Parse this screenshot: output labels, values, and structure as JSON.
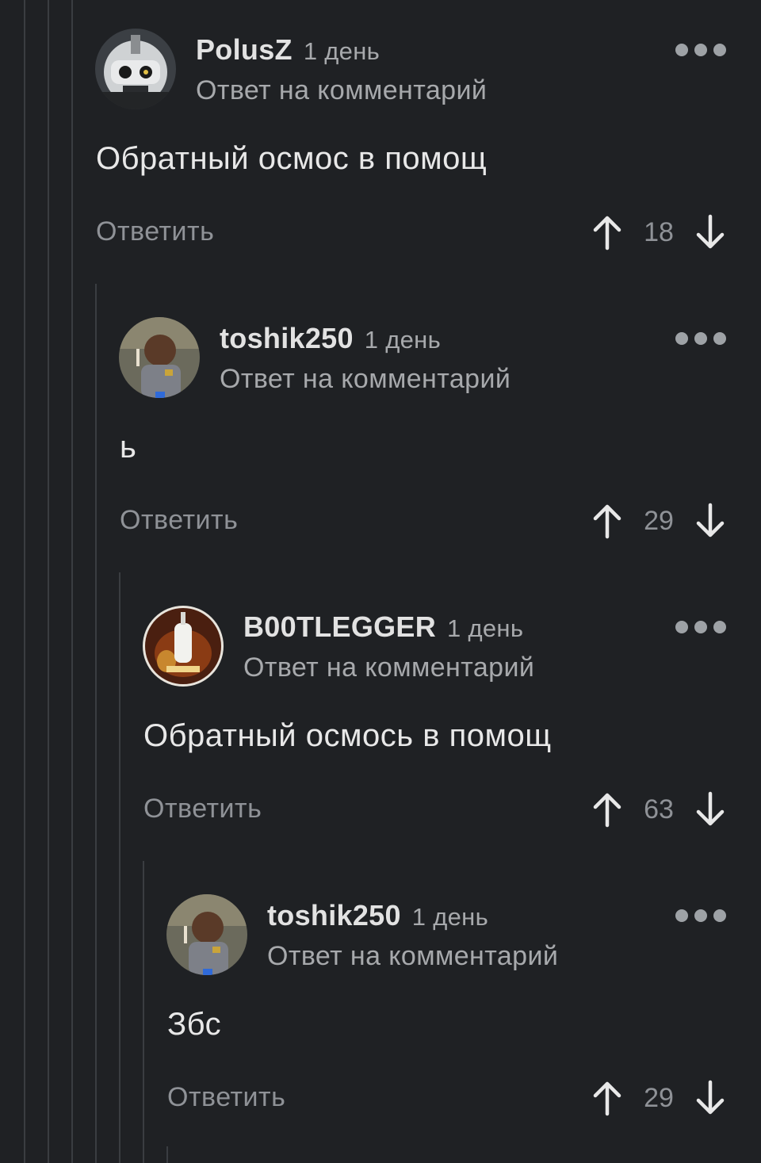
{
  "comments": [
    {
      "author": "PolusZ",
      "time": "1 день",
      "reply_to": "Ответ на комментарий",
      "text": "Обратный осмос в помощ",
      "reply_label": "Ответить",
      "rating": "18",
      "avatar": "robot-avatar"
    },
    {
      "author": "toshik250",
      "time": "1 день",
      "reply_to": "Ответ на комментарий",
      "text": "ь",
      "reply_label": "Ответить",
      "rating": "29",
      "avatar": "boy-avatar"
    },
    {
      "author": "B00TLEGGER",
      "time": "1 день",
      "reply_to": "Ответ на комментарий",
      "text": "Обратный осмось в помощ",
      "reply_label": "Ответить",
      "rating": "63",
      "avatar": "bottle-avatar"
    },
    {
      "author": "toshik250",
      "time": "1 день",
      "reply_to": "Ответ на комментарий",
      "text": "Збс",
      "reply_label": "Ответить",
      "rating": "29",
      "avatar": "boy-avatar"
    }
  ],
  "colors": {
    "background": "#1f2124",
    "thread_line": "#3a3d41",
    "muted_text": "#a7a9ac"
  }
}
